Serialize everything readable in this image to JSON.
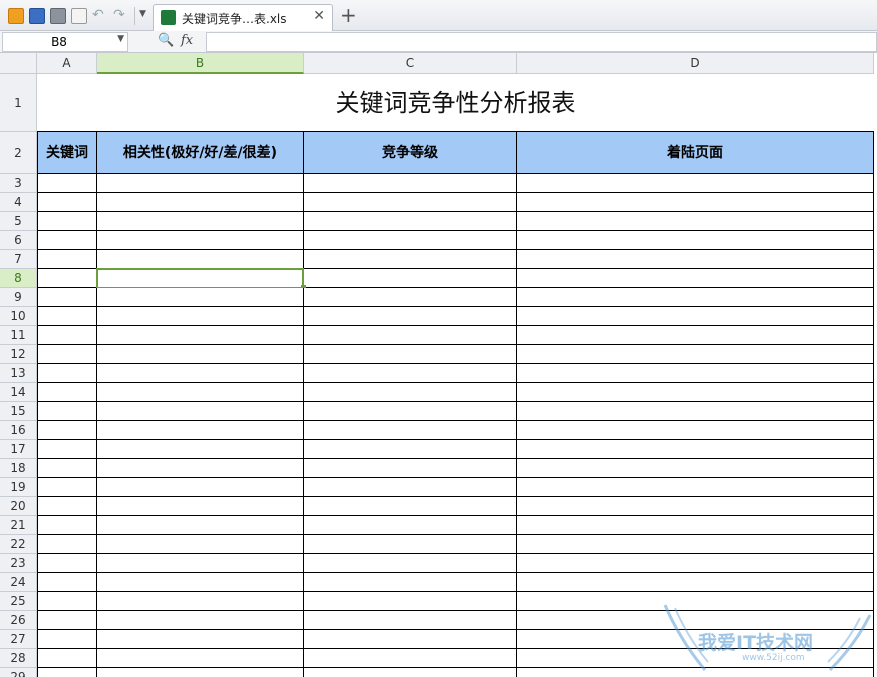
{
  "tab": {
    "title": "关键词竞争…表.xls",
    "close": "✕",
    "new_tab": "+"
  },
  "formula_bar": {
    "cell_ref": "B8",
    "fx_label": "fx",
    "value": ""
  },
  "columns": [
    "A",
    "B",
    "C",
    "D"
  ],
  "selected_column": "B",
  "rows": [
    "1",
    "2",
    "3",
    "4",
    "5",
    "6",
    "7",
    "8",
    "9",
    "10",
    "11",
    "12",
    "13",
    "14",
    "15",
    "16",
    "17",
    "18",
    "19",
    "20",
    "21",
    "22",
    "23",
    "24",
    "25",
    "26",
    "27",
    "28",
    "29"
  ],
  "selected_row": "8",
  "sheet": {
    "title": "关键词竞争性分析报表",
    "headers": [
      "关键词",
      "相关性(极好/好/差/很差)",
      "竞争等级",
      "着陆页面"
    ],
    "header_color": "#a3c9f6"
  },
  "watermark": {
    "text": "我爱IT技术网",
    "url": "www.52ij.com"
  },
  "colors": {
    "selection": "#6b9f3b",
    "header_fill": "#a3c9f6"
  }
}
